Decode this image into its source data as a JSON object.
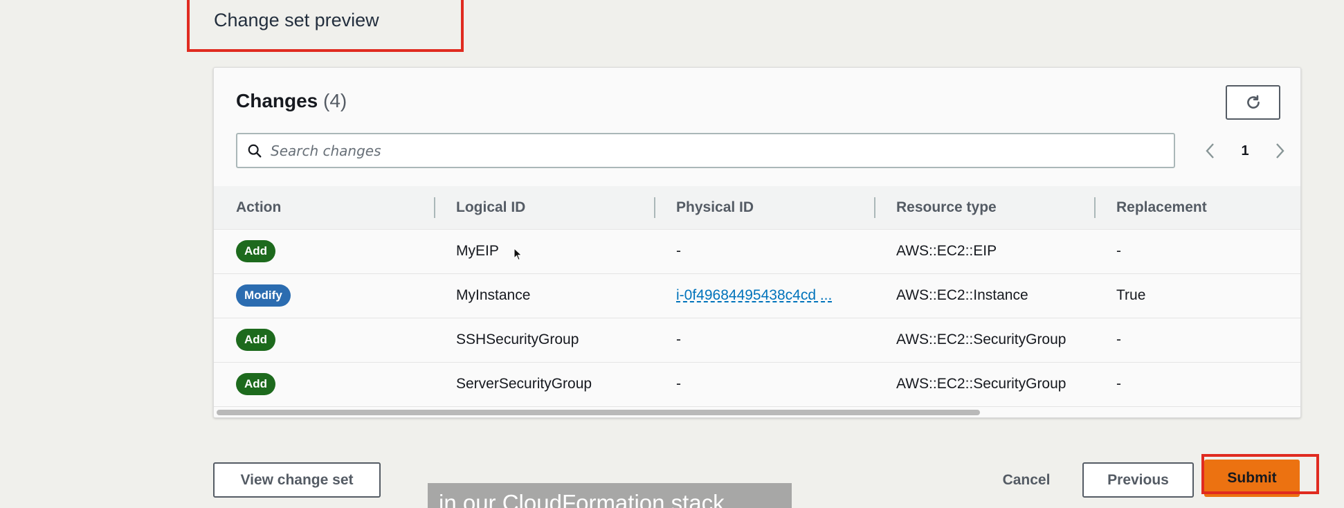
{
  "section_heading": "Change set preview",
  "changes": {
    "title": "Changes",
    "count": "(4)",
    "search_placeholder": "Search changes",
    "page": "1",
    "columns": [
      "Action",
      "Logical ID",
      "Physical ID",
      "Resource type",
      "Replacement"
    ],
    "rows": [
      {
        "action": "Add",
        "logical_id": "MyEIP",
        "physical_id": "-",
        "resource_type": "AWS::EC2::EIP",
        "replacement": "-"
      },
      {
        "action": "Modify",
        "logical_id": "MyInstance",
        "physical_id": "i-0f49684495438c4cd ...",
        "resource_type": "AWS::EC2::Instance",
        "replacement": "True"
      },
      {
        "action": "Add",
        "logical_id": "SSHSecurityGroup",
        "physical_id": "-",
        "resource_type": "AWS::EC2::SecurityGroup",
        "replacement": "-"
      },
      {
        "action": "Add",
        "logical_id": "ServerSecurityGroup",
        "physical_id": "-",
        "resource_type": "AWS::EC2::SecurityGroup",
        "replacement": "-"
      }
    ]
  },
  "buttons": {
    "view_change_set": "View change set",
    "cancel": "Cancel",
    "previous": "Previous",
    "submit": "Submit"
  },
  "caption": "in our CloudFormation stack.",
  "colors": {
    "add_badge": "#1d6a1d",
    "modify_badge": "#2b6cb0",
    "submit": "#ec7211",
    "highlight": "#e02b20",
    "link": "#0073bb"
  }
}
